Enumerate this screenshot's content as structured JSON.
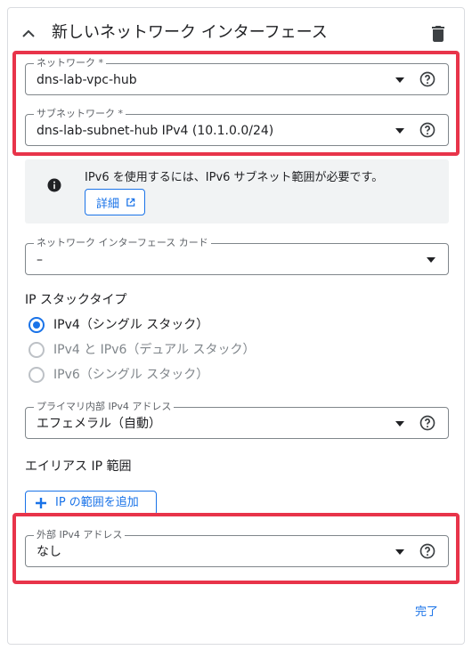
{
  "header": {
    "title": "新しいネットワーク インターフェース",
    "collapse_icon": "chevron-up-icon",
    "delete_icon": "trash-icon"
  },
  "network": {
    "label": "ネットワーク *",
    "value": "dns-lab-vpc-hub"
  },
  "subnetwork": {
    "label": "サブネットワーク *",
    "value": "dns-lab-subnet-hub IPv4 (10.1.0.0/24)"
  },
  "info": {
    "icon": "info-icon",
    "text": "IPv6 を使用するには、IPv6 サブネット範囲が必要です。",
    "detail_label": "詳細"
  },
  "nic_card": {
    "label": "ネットワーク インターフェース カード",
    "value": "–"
  },
  "ip_stack": {
    "title": "IP スタックタイプ",
    "options": [
      {
        "label": "IPv4（シングル スタック）",
        "selected": true,
        "enabled": true
      },
      {
        "label": "IPv4 と IPv6（デュアル スタック）",
        "selected": false,
        "enabled": false
      },
      {
        "label": "IPv6（シングル スタック）",
        "selected": false,
        "enabled": false
      }
    ]
  },
  "primary_ipv4": {
    "label": "プライマリ内部 IPv4 アドレス",
    "value": "エフェメラル（自動）"
  },
  "alias_ip": {
    "title": "エイリアス IP 範囲",
    "add_label": "IP の範囲を追加"
  },
  "external_ipv4": {
    "label": "外部 IPv4 アドレス",
    "value": "なし"
  },
  "footer": {
    "done_label": "完了"
  },
  "colors": {
    "accent": "#1a73e8",
    "highlight": "#e8344a",
    "info_bg": "#f1f3f4"
  }
}
